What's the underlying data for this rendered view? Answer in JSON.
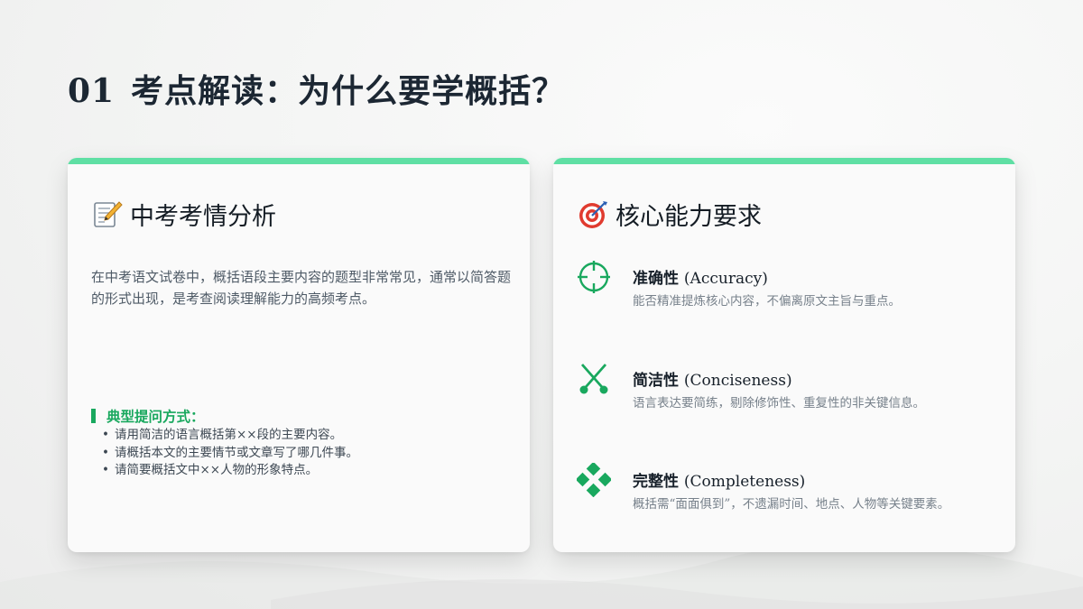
{
  "page": {
    "number": "01",
    "title": "考点解读：为什么要学概括？"
  },
  "colors": {
    "accent": "#5fdfa4",
    "green": "#19a85e",
    "title": "#1c2733"
  },
  "left_card": {
    "icon": "memo-emoji-icon",
    "title": "中考考情分析",
    "description": "在中考语文试卷中，概括语段主要内容的题型非常常见，通常以简答题的形式出现，是考查阅读理解能力的高频考点。",
    "questions_heading": "典型提问方式：",
    "questions": [
      "请用简洁的语言概括第××段的主要内容。",
      "请概括本文的主要情节或文章写了哪几件事。",
      "请简要概括文中××人物的形象特点。"
    ]
  },
  "right_card": {
    "icon": "target-emoji-icon",
    "title": "核心能力要求",
    "abilities": [
      {
        "icon": "crosshair-icon",
        "name": "准确性",
        "en": "(Accuracy)",
        "desc": "能否精准提炼核心内容，不偏离原文主旨与重点。"
      },
      {
        "icon": "scissors-icon",
        "name": "简洁性",
        "en": "(Conciseness)",
        "desc": "语言表达要简练，剔除修饰性、重复性的非关键信息。"
      },
      {
        "icon": "diamond-cluster-icon",
        "name": "完整性",
        "en": "(Completeness)",
        "desc": "概括需“面面俱到”，不遗漏时间、地点、人物等关键要素。"
      }
    ]
  }
}
